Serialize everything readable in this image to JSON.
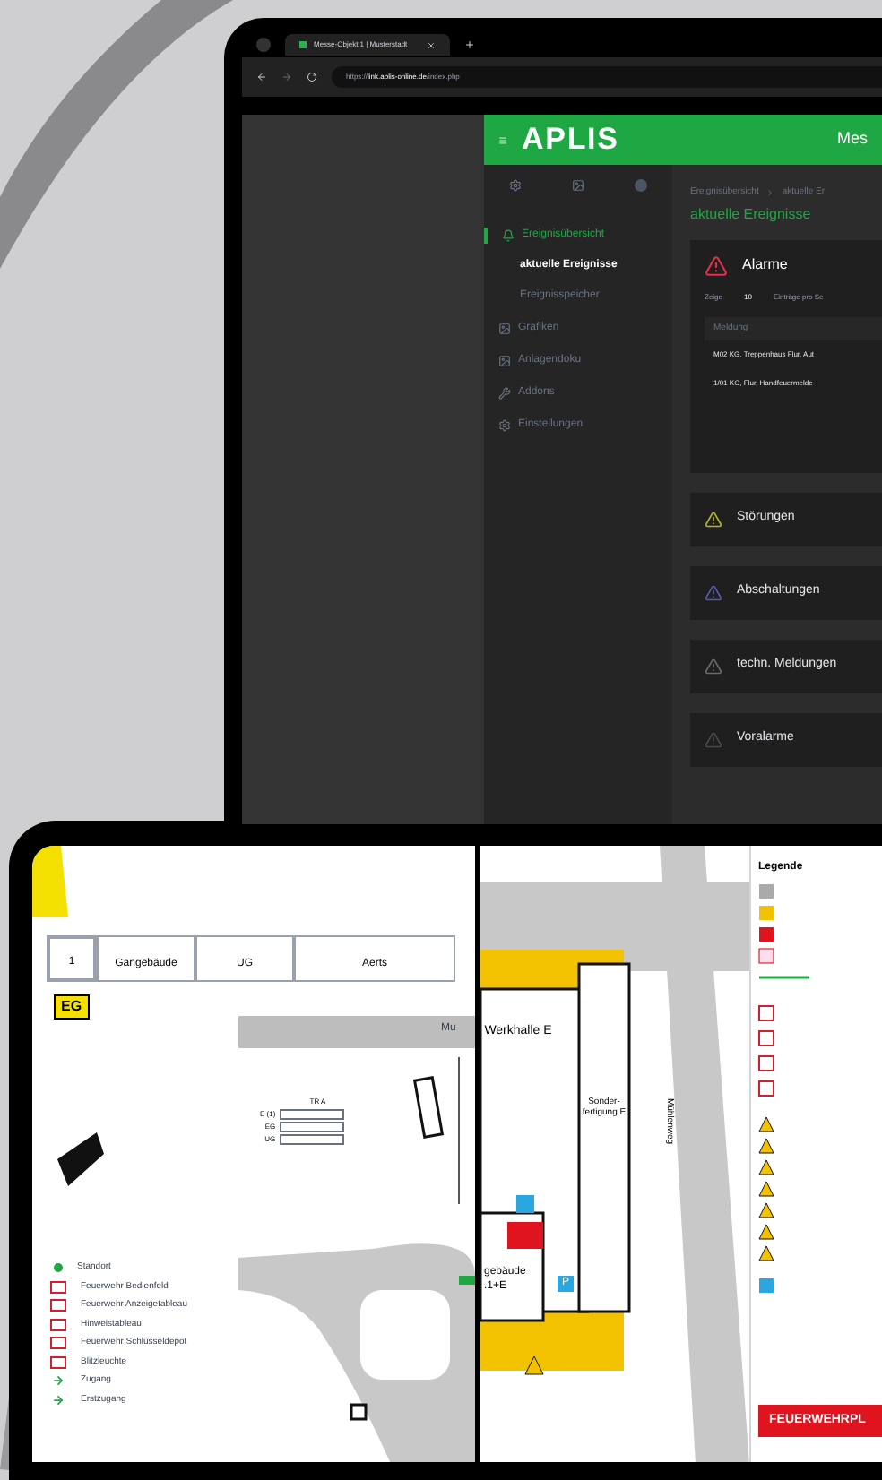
{
  "browser": {
    "tab_title": "Messe-Objekt 1 | Musterstadt",
    "url_scheme": "https://",
    "url_host": "link.aplis-online.de",
    "url_path": "/index.php"
  },
  "app": {
    "logo": "APLIS",
    "header_title": "Mes",
    "breadcrumb": [
      "Ereignisübersicht",
      "aktuelle Er"
    ],
    "page_title": "aktuelle Ereignisse"
  },
  "sidebar": {
    "items": [
      {
        "label": "Ereignisübersicht",
        "selected": true,
        "children": [
          {
            "label": "aktuelle Ereignisse",
            "selected": true
          },
          {
            "label": "Ereignisspeicher",
            "selected": false
          }
        ]
      },
      {
        "label": "Grafiken",
        "selected": false
      },
      {
        "label": "Anlagendoku",
        "selected": false
      },
      {
        "label": "Addons",
        "selected": false
      },
      {
        "label": "Einstellungen",
        "selected": false
      }
    ]
  },
  "alarm_panel": {
    "title": "Alarme",
    "color": "#e0314b",
    "show_label": "Zeige",
    "page_size": "10",
    "entries_label": "Einträge pro Se",
    "column": "Meldung",
    "rows": [
      "M02 KG, Treppenhaus Flur, Aut",
      "1/01 KG, Flur, Handfeuermelde"
    ]
  },
  "panels": [
    {
      "title": "Störungen",
      "color": "#b5b52a"
    },
    {
      "title": "Abschaltungen",
      "color": "#5a5aa8"
    },
    {
      "title": "techn. Meldungen",
      "color": "#6a6a6a"
    },
    {
      "title": "Voralarme",
      "color": "#4a4a4a"
    }
  ],
  "plan_left": {
    "info_cells": [
      "1",
      "Gangebäude",
      "UG",
      "Aerts"
    ],
    "floor": "EG",
    "street": "Mu",
    "stair_title": "TR A",
    "stair_levels": [
      "E (1)",
      "EG",
      "UG"
    ],
    "legend": [
      {
        "label": "Standort",
        "kind": "dot"
      },
      {
        "label": "Feuerwehr Bedienfeld",
        "kind": "box"
      },
      {
        "label": "Feuerwehr Anzeigetableau",
        "kind": "box"
      },
      {
        "label": "Hinweistableau",
        "kind": "box"
      },
      {
        "label": "Feuerwehr Schlüsseldepot",
        "kind": "box"
      },
      {
        "label": "Blitzleuchte",
        "kind": "box"
      },
      {
        "label": "Zugang",
        "kind": "arrow"
      },
      {
        "label": "Erstzugang",
        "kind": "arrow"
      }
    ]
  },
  "plan_right": {
    "buildings": [
      "Werkhalle E",
      "Sonder-fertigung E",
      "gebäude .1+E"
    ],
    "street": "Mühlenweg",
    "parking": "P",
    "legend_title": "Legende",
    "banner": "FEUERWEHRPL"
  }
}
